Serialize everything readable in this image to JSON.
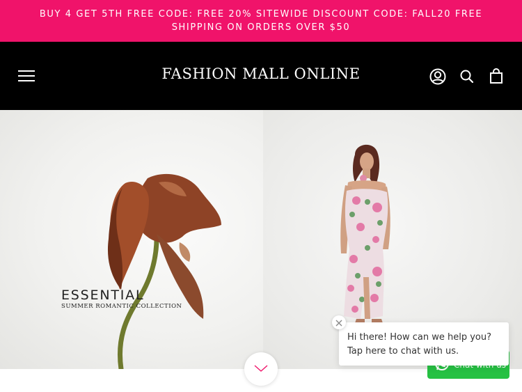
{
  "announcement": {
    "text": "BUY 4 GET 5TH FREE CODE: FREE  20% SITEWIDE DISCOUNT CODE: FALL20  FREE SHIPPING ON ORDERS OVER $50",
    "color": "#f0136a"
  },
  "header": {
    "brand": "FASHION MALL ONLINE",
    "background": "#000000",
    "icons": [
      "menu-icon",
      "account-icon",
      "search-icon",
      "cart-icon"
    ]
  },
  "hero": {
    "left": {
      "title": "ESSENTIAL",
      "subtitle": "SUMMER ROMANTIC COLLECTION",
      "image": "dried-flower"
    },
    "right": {
      "image": "model-floral-dress"
    }
  },
  "scroll_down": {
    "icon": "chevron-down-icon"
  },
  "chat": {
    "message": "Hi there! How can we help you? Tap here to chat with us.",
    "button_label": "Chat with us",
    "button_color": "#26c143",
    "icons": [
      "close-icon",
      "whatsapp-icon"
    ]
  }
}
